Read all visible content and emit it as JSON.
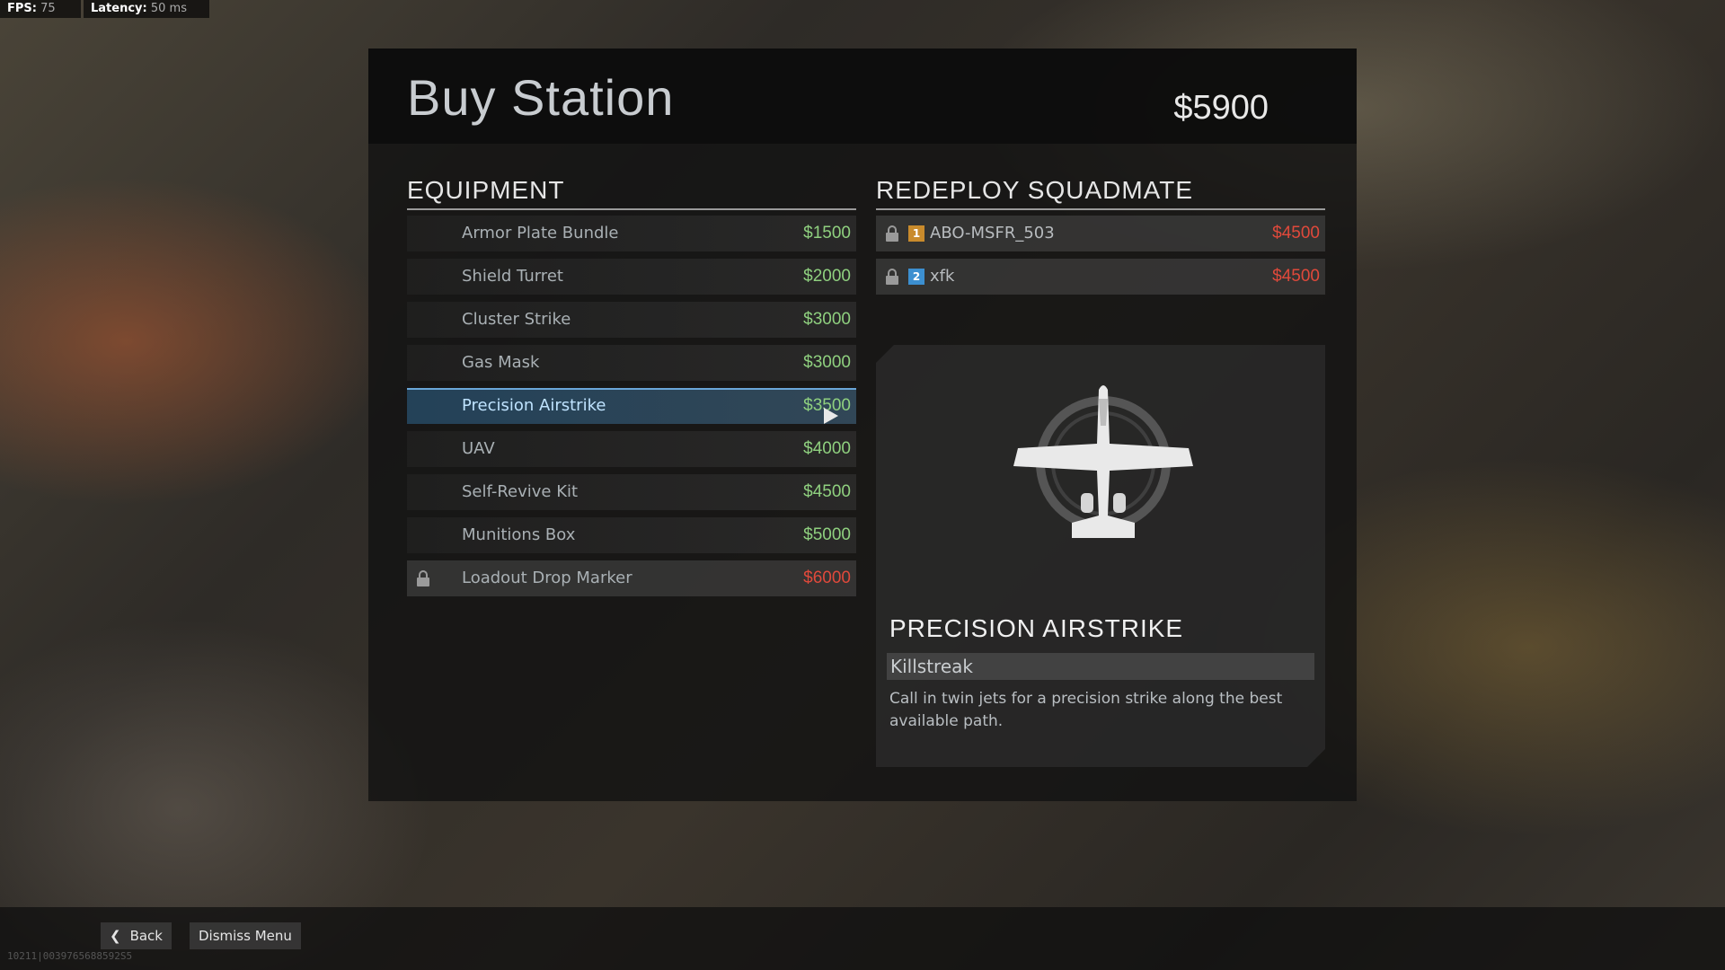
{
  "hud": {
    "fps_label": "FPS:",
    "fps_value": "75",
    "latency_label": "Latency:",
    "latency_value": "50 ms"
  },
  "header": {
    "title": "Buy Station",
    "money": "$5900"
  },
  "equipment": {
    "title": "EQUIPMENT",
    "items": [
      {
        "label": "Armor Plate Bundle",
        "price": "$1500"
      },
      {
        "label": "Shield Turret",
        "price": "$2000"
      },
      {
        "label": "Cluster Strike",
        "price": "$3000"
      },
      {
        "label": "Gas Mask",
        "price": "$3000"
      },
      {
        "label": "Precision Airstrike",
        "price": "$3500",
        "selected": true
      },
      {
        "label": "UAV",
        "price": "$4000"
      },
      {
        "label": "Self-Revive Kit",
        "price": "$4500"
      },
      {
        "label": "Munitions Box",
        "price": "$5000"
      },
      {
        "label": "Loadout Drop Marker",
        "price": "$6000",
        "locked": true
      }
    ]
  },
  "redeploy": {
    "title": "REDEPLOY SQUADMATE",
    "items": [
      {
        "badge": "1",
        "badge_color": "#c98b2c",
        "name": "ABO-MSFR_503",
        "price": "$4500"
      },
      {
        "badge": "2",
        "badge_color": "#3c8fd0",
        "name": "xfk",
        "price": "$4500"
      }
    ]
  },
  "detail": {
    "icon": "airplane-icon",
    "title": "PRECISION AIRSTRIKE",
    "type": "Killstreak",
    "description": "Call in twin jets for a precision strike along the best available path."
  },
  "footer": {
    "back_label": "Back",
    "dismiss_label": "Dismiss Menu",
    "build_id": "10211|0039765688592S5"
  },
  "colors": {
    "affordable": "#8fd07f",
    "unaffordable": "#e0493b",
    "selected_accent": "#6aa6d8"
  }
}
